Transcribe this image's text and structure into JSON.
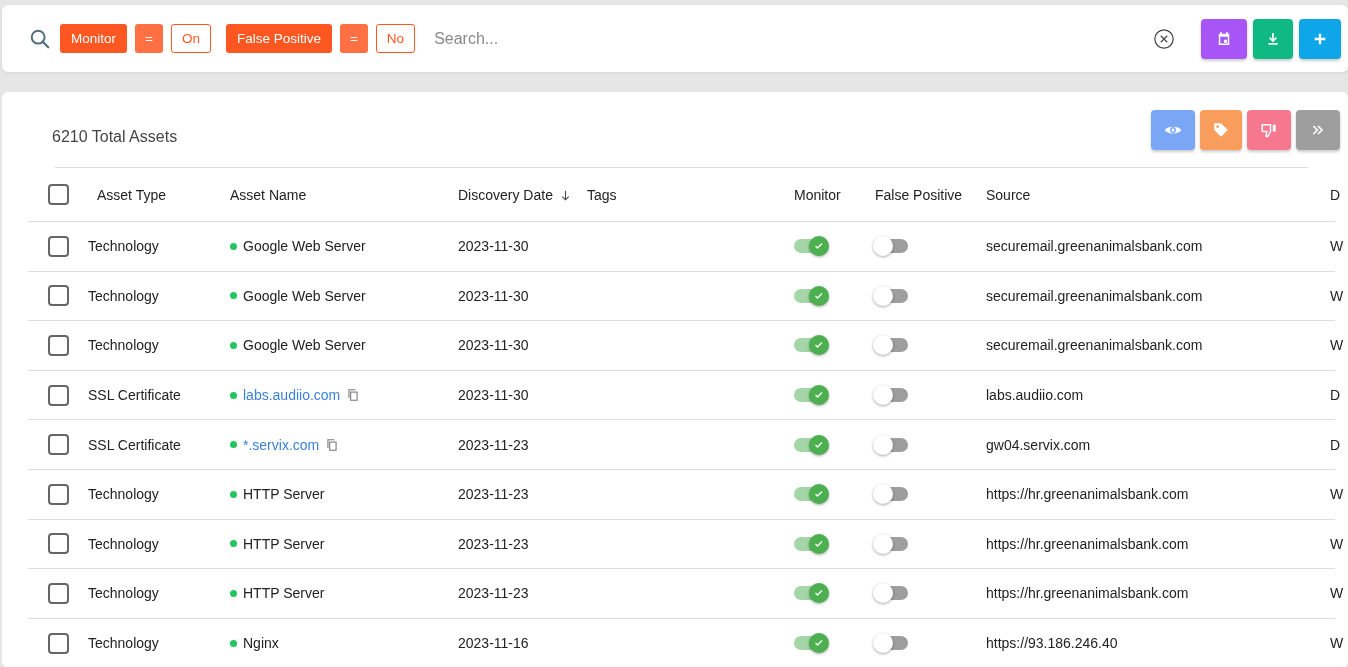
{
  "filter_bar": {
    "filters": [
      {
        "field": "Monitor",
        "operator": "=",
        "value": "On"
      },
      {
        "field": "False Positive",
        "operator": "=",
        "value": "No"
      }
    ],
    "search": {
      "placeholder": "Search..."
    }
  },
  "total": "6210 Total Assets",
  "table": {
    "select_all": {
      "checked": false
    },
    "columns": [
      {
        "label": "Asset Type",
        "sorted": false
      },
      {
        "label": "Asset Name",
        "sorted": false
      },
      {
        "label": "Discovery Date",
        "sorted": true
      },
      {
        "label": "Tags",
        "sorted": false
      },
      {
        "label": "Monitor",
        "sorted": false
      },
      {
        "label": "False Positive",
        "sorted": false
      },
      {
        "label": "Source",
        "sorted": false
      },
      {
        "label": "D",
        "sorted": false
      }
    ],
    "rows": [
      {
        "selected": false,
        "asset_type": "Technology",
        "asset_name": "Google Web Server",
        "link": false,
        "discovery_date": "2023-11-30",
        "monitor": true,
        "false_positive": false,
        "source": "securemail.greenanimalsbank.com",
        "column_9": "W"
      },
      {
        "selected": false,
        "asset_type": "Technology",
        "asset_name": "Google Web Server",
        "link": false,
        "discovery_date": "2023-11-30",
        "monitor": true,
        "false_positive": false,
        "source": "securemail.greenanimalsbank.com",
        "column_9": "W"
      },
      {
        "selected": false,
        "asset_type": "Technology",
        "asset_name": "Google Web Server",
        "link": false,
        "discovery_date": "2023-11-30",
        "monitor": true,
        "false_positive": false,
        "source": "securemail.greenanimalsbank.com",
        "column_9": "W"
      },
      {
        "selected": false,
        "asset_type": "SSL Certificate",
        "asset_name": "labs.audiio.com",
        "link": true,
        "discovery_date": "2023-11-30",
        "monitor": true,
        "false_positive": false,
        "source": "labs.audiio.com",
        "column_9": "D"
      },
      {
        "selected": false,
        "asset_type": "SSL Certificate",
        "asset_name": "*.servix.com",
        "link": true,
        "discovery_date": "2023-11-23",
        "monitor": true,
        "false_positive": false,
        "source": "gw04.servix.com",
        "column_9": "D"
      },
      {
        "selected": false,
        "asset_type": "Technology",
        "asset_name": "HTTP Server",
        "link": false,
        "discovery_date": "2023-11-23",
        "monitor": true,
        "false_positive": false,
        "source": "https://hr.greenanimalsbank.com",
        "column_9": "W"
      },
      {
        "selected": false,
        "asset_type": "Technology",
        "asset_name": "HTTP Server",
        "link": false,
        "discovery_date": "2023-11-23",
        "monitor": true,
        "false_positive": false,
        "source": "https://hr.greenanimalsbank.com",
        "column_9": "W"
      },
      {
        "selected": false,
        "asset_type": "Technology",
        "asset_name": "HTTP Server",
        "link": false,
        "discovery_date": "2023-11-23",
        "monitor": true,
        "false_positive": false,
        "source": "https://hr.greenanimalsbank.com",
        "column_9": "W"
      },
      {
        "selected": false,
        "asset_type": "Technology",
        "asset_name": "Nginx",
        "link": false,
        "discovery_date": "2023-11-16",
        "monitor": true,
        "false_positive": false,
        "source": "https://93.186.246.40",
        "column_9": "W"
      }
    ]
  }
}
